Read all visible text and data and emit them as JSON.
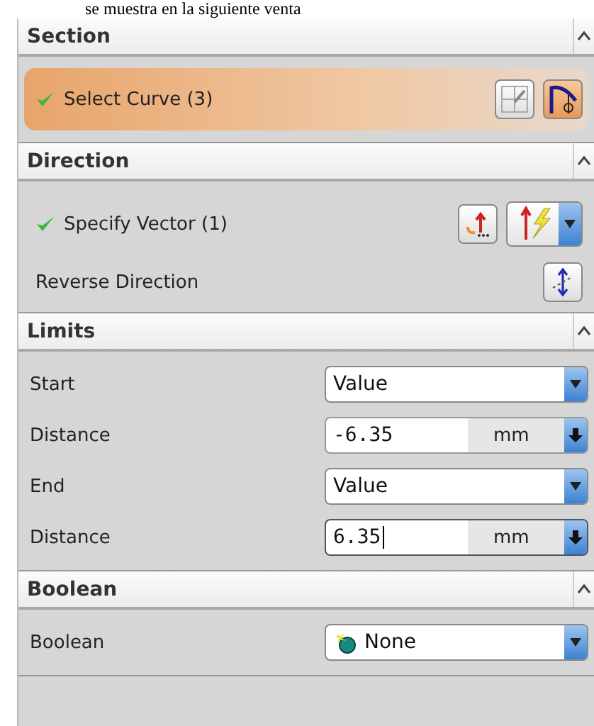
{
  "caption": "se muestra en la siguiente venta",
  "sections": [
    {
      "title": "Section",
      "expanded": true,
      "rows": [
        {
          "kind": "selection",
          "label": "Select Curve (3)",
          "done": true,
          "selected": true
        }
      ]
    },
    {
      "title": "Direction",
      "expanded": true,
      "rows": [
        {
          "kind": "vector",
          "label": "Specify Vector (1)",
          "done": true,
          "selected": false
        },
        {
          "kind": "toggle",
          "label": "Reverse Direction"
        }
      ]
    },
    {
      "title": "Limits",
      "expanded": true,
      "rows": [
        {
          "kind": "combo",
          "label": "Start",
          "value": "Value"
        },
        {
          "kind": "distance",
          "label": "Distance",
          "value": "-6.35",
          "unit": "mm",
          "focused": false
        },
        {
          "kind": "combo",
          "label": "End",
          "value": "Value"
        },
        {
          "kind": "distance",
          "label": "Distance",
          "value": "6.35",
          "unit": "mm",
          "focused": true
        }
      ]
    },
    {
      "title": "Boolean",
      "expanded": true,
      "rows": [
        {
          "kind": "boolean",
          "label": "Boolean",
          "value": "None"
        }
      ]
    }
  ]
}
